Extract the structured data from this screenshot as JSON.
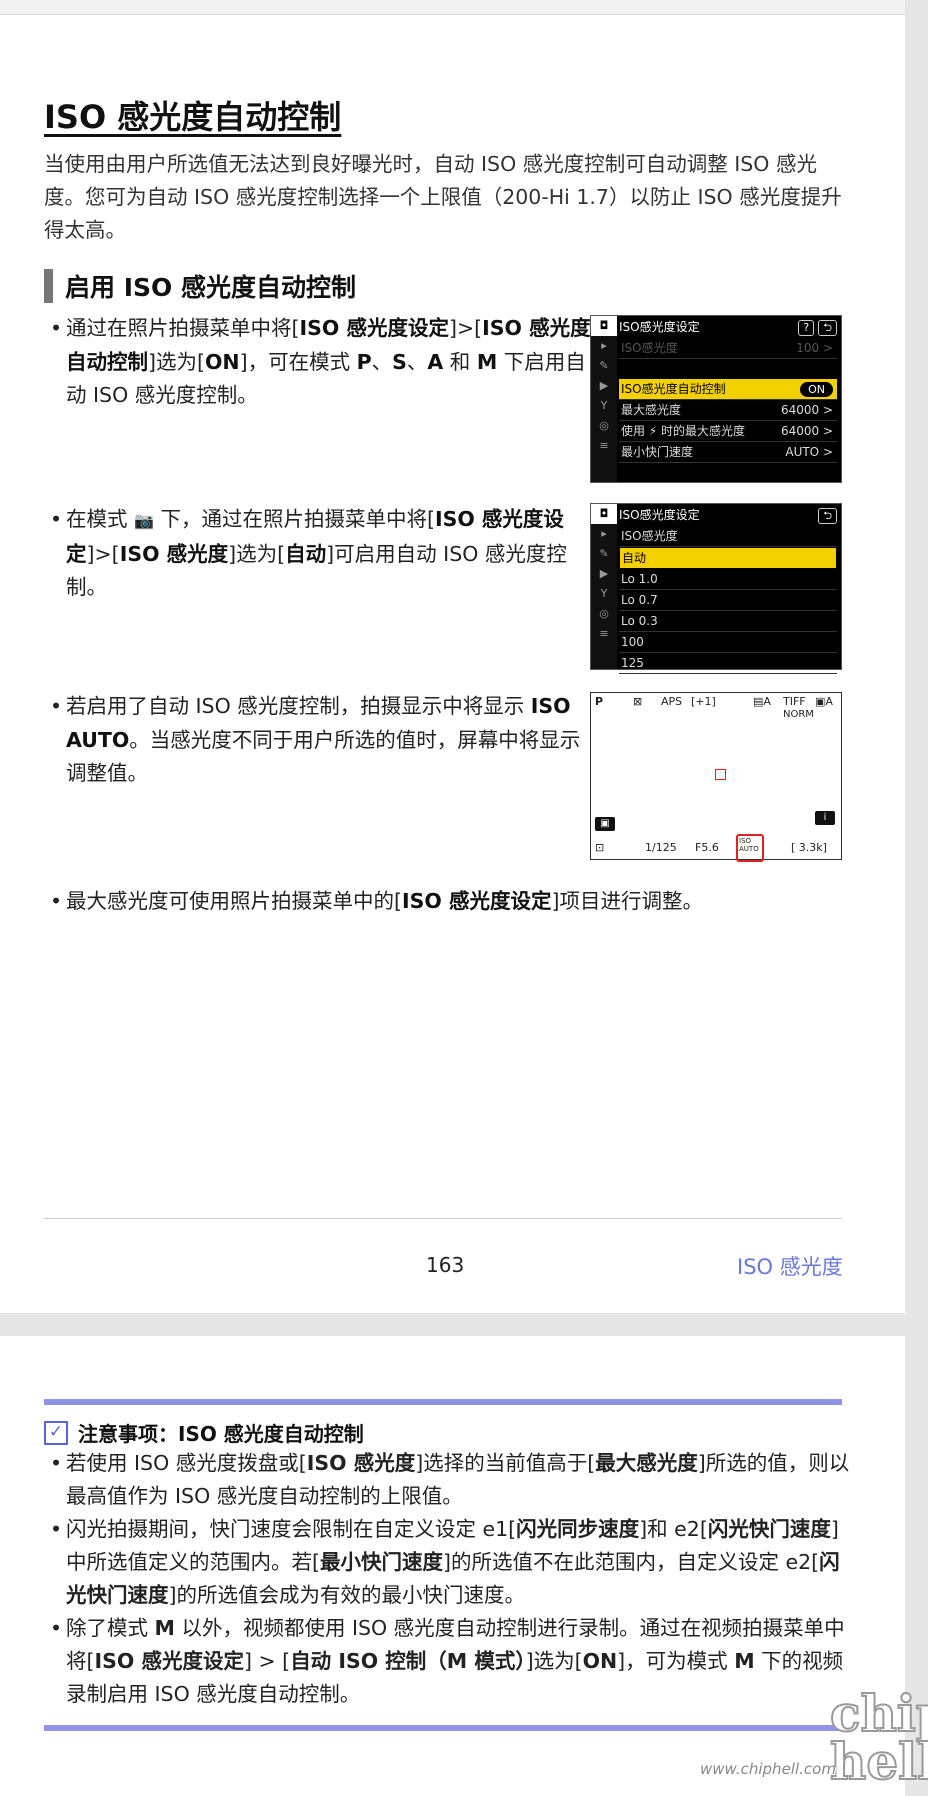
{
  "page1": {
    "title": "ISO 感光度自动控制",
    "intro": "当使用由用户所选值无法达到良好曝光时，自动 ISO 感光度控制可自动调整 ISO 感光度。您可为自动 ISO 感光度控制选择一个上限值（200-Hi 1.7）以防止 ISO 感光度提升得太高。",
    "section_title": "启用 ISO 感光度自动控制",
    "bullets": {
      "b1": {
        "t1": "通过在照片拍摄菜单中将[",
        "s1": "ISO 感光度设定",
        "t2": "]>[",
        "s2": "ISO 感光度自动控制",
        "t3": "]选为[",
        "s3": "ON",
        "t4": "]，可在模式 ",
        "s4": "P",
        "t5": "、",
        "s5": "S",
        "t6": "、",
        "s6": "A",
        "t7": " 和 ",
        "s7": "M",
        "t8": " 下启用自动 ISO 感光度控制。"
      },
      "b2": {
        "t1": "在模式 ",
        "icon": "AUTO",
        "t2": " 下，通过在照片拍摄菜单中将[",
        "s1": "ISO 感光度设定",
        "t3": "]>[",
        "s2": "ISO 感光度",
        "t4": "]选为[",
        "s3": "自动",
        "t5": "]可启用自动 ISO 感光度控制。"
      },
      "b3": {
        "t1": "若启用了自动 ISO 感光度控制，拍摄显示中将显示 ",
        "s1": "ISO AUTO",
        "t2": "。当感光度不同于用户所选的值时，屏幕中将显示调整值。"
      },
      "b4": {
        "t1": "最大感光度可使用照片拍摄菜单中的[",
        "s1": "ISO 感光度设定",
        "t2": "]项目进行调整。"
      }
    },
    "screen1": {
      "title": "ISO感光度设定",
      "help": "?",
      "back": "⮌",
      "rows": [
        {
          "label": "ISO感光度",
          "value": "100 >"
        },
        {
          "label": "",
          "value": ""
        },
        {
          "label": "ISO感光度自动控制",
          "value": "ON"
        },
        {
          "label": "最大感光度",
          "value": "64000 >"
        },
        {
          "label": "使用 ⚡ 时的最大感光度",
          "value": "64000 >"
        },
        {
          "label": "最小快门速度",
          "value": "AUTO >"
        }
      ]
    },
    "screen2": {
      "title": "ISO感光度设定",
      "back": "⮌",
      "subtitle": "ISO感光度",
      "rows": [
        "自动",
        "Lo 1.0",
        "Lo 0.7",
        "Lo 0.3",
        "100",
        "125"
      ]
    },
    "liveview": {
      "mode": "P",
      "t1": "⊠",
      "t2": "APS",
      "t3": "[+1]",
      "t4": "▤A",
      "t5": "Q",
      "t6": "TIFF",
      "t7": "▣A",
      "norm": "NORM",
      "shutter": "1/125",
      "aperture": "F5.6",
      "iso": "ISO AUTO",
      "frames": "[ 3.3k]",
      "info": "i"
    },
    "page_number": "163",
    "running_title": "ISO 感光度"
  },
  "page2": {
    "note_title": "注意事项：ISO 感光度自动控制",
    "n1": {
      "t1": "若使用 ISO 感光度拨盘或[",
      "s1": "ISO 感光度",
      "t2": "]选择的当前值高于[",
      "s2": "最大感光度",
      "t3": "]所选的值，则以最高值作为 ISO 感光度自动控制的上限值。"
    },
    "n2": {
      "t1": "闪光拍摄期间，快门速度会限制在自定义设定 e1[",
      "s1": "闪光同步速度",
      "t2": "]和 e2[",
      "s2": "闪光快门速度",
      "t3": "]中所选值定义的范围内。若[",
      "s3": "最小快门速度",
      "t4": "]的所选值不在此范围内，自定义设定 e2[",
      "s4": "闪光快门速度",
      "t5": "]的所选值会成为有效的最小快门速度。"
    },
    "n3": {
      "t1": "除了模式 ",
      "s1": "M",
      "t2": " 以外，视频都使用 ISO 感光度自动控制进行录制。通过在视频拍摄菜单中将[",
      "s2": "ISO 感光度设定",
      "t3": "] > [",
      "s3": "自动 ISO 控制（M 模式）",
      "t4": "]选为[",
      "s4": "ON",
      "t5": "]，可为模式 ",
      "s5": "M",
      "t6": " 下的视频录制启用 ISO 感光度自动控制。"
    }
  },
  "watermark": {
    "url": "www.chiphell.com",
    "logo": "chip hell"
  }
}
